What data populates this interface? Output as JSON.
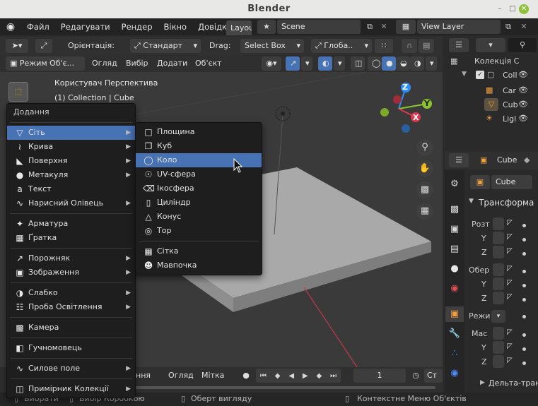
{
  "window": {
    "title": "Blender"
  },
  "menubar": {
    "items": [
      "Файл",
      "Редагувати",
      "Рендер",
      "Вікно",
      "Довідка"
    ],
    "workspace_tab": "Layou",
    "scene": "Scene",
    "view_layer": "View Layer"
  },
  "header": {
    "orientation_label": "Орієнтація:",
    "orientation_value": "Стандарт",
    "drag_label": "Drag:",
    "drag_value": "Select Box",
    "pivot_value": "Глоба..",
    "mode": "Режим Об'є...",
    "view": "Огляд",
    "select": "Вибір",
    "add": "Додати",
    "object": "Об'єкт"
  },
  "viewport": {
    "view_name": "Користувач Перспектива",
    "collection_info": "(1) Collection | Cube",
    "gizmo": {
      "z": "Z",
      "y": "Y",
      "x": "X"
    }
  },
  "add_menu": {
    "title": "Додання",
    "items": [
      {
        "label": "Сіть",
        "icon": "mesh-icon",
        "submenu": true
      },
      {
        "label": "Крива",
        "icon": "curve-icon",
        "submenu": true
      },
      {
        "label": "Поверхня",
        "icon": "surface-icon",
        "submenu": true
      },
      {
        "label": "Метакуля",
        "icon": "metaball-icon",
        "submenu": true
      },
      {
        "label": "Текст",
        "icon": "text-icon",
        "submenu": false
      },
      {
        "label": "Нарисний Олівець",
        "icon": "grease-pencil-icon",
        "submenu": true
      },
      {
        "label": "Арматура",
        "icon": "armature-icon",
        "submenu": false
      },
      {
        "label": "Ґратка",
        "icon": "lattice-icon",
        "submenu": false
      },
      {
        "label": "Порожняк",
        "icon": "empty-icon",
        "submenu": true
      },
      {
        "label": "Зображення",
        "icon": "image-icon",
        "submenu": true
      },
      {
        "label": "Слабко",
        "icon": "light-icon",
        "submenu": true
      },
      {
        "label": "Проба Освітлення",
        "icon": "light-probe-icon",
        "submenu": true
      },
      {
        "label": "Камера",
        "icon": "camera-icon",
        "submenu": false
      },
      {
        "label": "Гучномовець",
        "icon": "speaker-icon",
        "submenu": false
      },
      {
        "label": "Силове поле",
        "icon": "force-field-icon",
        "submenu": true
      },
      {
        "label": "Примірник Колекції",
        "icon": "collection-instance-icon",
        "submenu": true
      }
    ]
  },
  "mesh_submenu": {
    "items": [
      {
        "label": "Площина",
        "icon": "plane-icon"
      },
      {
        "label": "Куб",
        "icon": "cube-icon"
      },
      {
        "label": "Коло",
        "icon": "circle-icon"
      },
      {
        "label": "UV-сфера",
        "icon": "uv-sphere-icon"
      },
      {
        "label": "Ікосфера",
        "icon": "icosphere-icon"
      },
      {
        "label": "Циліндр",
        "icon": "cylinder-icon"
      },
      {
        "label": "Конус",
        "icon": "cone-icon"
      },
      {
        "label": "Тор",
        "icon": "torus-icon"
      },
      {
        "label": "Сітка",
        "icon": "grid-icon"
      },
      {
        "label": "Мавпочка",
        "icon": "monkey-icon"
      }
    ]
  },
  "outliner": {
    "items": [
      "Колекція С",
      "Coll",
      "Car",
      "Cub",
      "Ligl"
    ]
  },
  "properties": {
    "object_name": "Cube",
    "object_field": "Cube",
    "section": "Трансформа",
    "rows": [
      "Розт",
      "Y",
      "Z",
      "Обер",
      "Y",
      "Z",
      "Режи",
      "Мас",
      "Y",
      "Z"
    ],
    "delta": "Дельта-тран"
  },
  "timeline": {
    "mode_partial": "ння",
    "view": "Огляд",
    "marker": "Мітка",
    "frame": "1",
    "end_partial": "Ст"
  },
  "statusbar": {
    "select": "Вибрати",
    "box_select": "Вибір Коробкою",
    "rotate_view": "Оберт вигляду",
    "context_menu": "Контекстне Меню Об'єктів"
  },
  "colors": {
    "accent": "#4772b3",
    "axis_x": "#e0384c",
    "axis_y": "#8bc22e",
    "axis_z": "#2c8fff"
  }
}
